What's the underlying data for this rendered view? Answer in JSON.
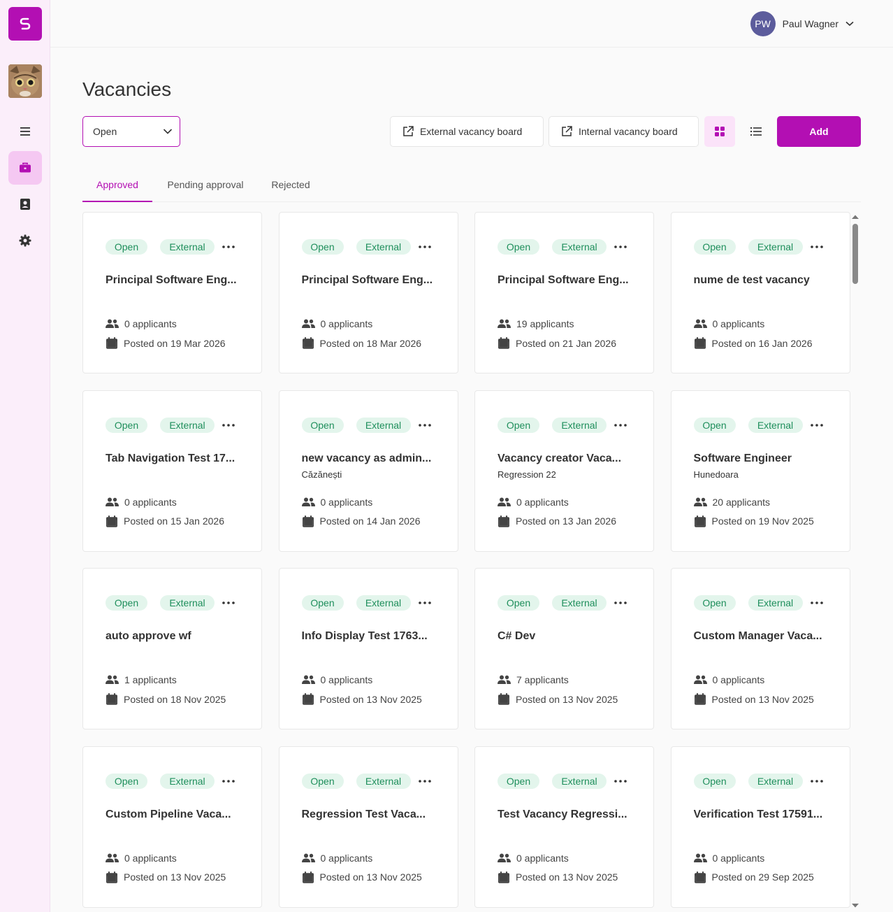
{
  "user": {
    "initials": "PW",
    "name": "Paul Wagner"
  },
  "page": {
    "title": "Vacancies",
    "status_filter": "Open",
    "external_board_label": "External vacancy board",
    "internal_board_label": "Internal vacancy board",
    "add_label": "Add"
  },
  "tabs": [
    {
      "label": "Approved",
      "active": true
    },
    {
      "label": "Pending approval",
      "active": false
    },
    {
      "label": "Rejected",
      "active": false
    }
  ],
  "colors": {
    "brand": "#b30fb3",
    "sidebar": "#fbeefa",
    "pill_bg": "#e3f5ec",
    "pill_text": "#1f8f5c"
  },
  "cards": [
    {
      "status": "Open",
      "visibility": "External",
      "title": "Principal Software Eng...",
      "subtitle": "",
      "applicants": "0 applicants",
      "posted": "Posted on 19 Mar 2026"
    },
    {
      "status": "Open",
      "visibility": "External",
      "title": "Principal Software Eng...",
      "subtitle": "",
      "applicants": "0 applicants",
      "posted": "Posted on 18 Mar 2026"
    },
    {
      "status": "Open",
      "visibility": "External",
      "title": "Principal Software Eng...",
      "subtitle": "",
      "applicants": "19 applicants",
      "posted": "Posted on 21 Jan 2026"
    },
    {
      "status": "Open",
      "visibility": "External",
      "title": "nume de test vacancy",
      "subtitle": "",
      "applicants": "0 applicants",
      "posted": "Posted on 16 Jan 2026"
    },
    {
      "status": "Open",
      "visibility": "External",
      "title": "Tab Navigation Test 17...",
      "subtitle": "",
      "applicants": "0 applicants",
      "posted": "Posted on 15 Jan 2026"
    },
    {
      "status": "Open",
      "visibility": "External",
      "title": "new vacancy as admin...",
      "subtitle": "Căzănești",
      "applicants": "0 applicants",
      "posted": "Posted on 14 Jan 2026"
    },
    {
      "status": "Open",
      "visibility": "External",
      "title": "Vacancy creator Vaca...",
      "subtitle": "Regression 22",
      "applicants": "0 applicants",
      "posted": "Posted on 13 Jan 2026"
    },
    {
      "status": "Open",
      "visibility": "External",
      "title": "Software Engineer",
      "subtitle": "Hunedoara",
      "applicants": "20 applicants",
      "posted": "Posted on 19 Nov 2025"
    },
    {
      "status": "Open",
      "visibility": "External",
      "title": "auto approve wf",
      "subtitle": "",
      "applicants": "1 applicants",
      "posted": "Posted on 18 Nov 2025"
    },
    {
      "status": "Open",
      "visibility": "External",
      "title": "Info Display Test 1763...",
      "subtitle": "",
      "applicants": "0 applicants",
      "posted": "Posted on 13 Nov 2025"
    },
    {
      "status": "Open",
      "visibility": "External",
      "title": "C# Dev",
      "subtitle": "",
      "applicants": "7 applicants",
      "posted": "Posted on 13 Nov 2025"
    },
    {
      "status": "Open",
      "visibility": "External",
      "title": "Custom Manager Vaca...",
      "subtitle": "",
      "applicants": "0 applicants",
      "posted": "Posted on 13 Nov 2025"
    },
    {
      "status": "Open",
      "visibility": "External",
      "title": "Custom Pipeline Vaca...",
      "subtitle": "",
      "applicants": "0 applicants",
      "posted": "Posted on 13 Nov 2025"
    },
    {
      "status": "Open",
      "visibility": "External",
      "title": "Regression Test Vaca...",
      "subtitle": "",
      "applicants": "0 applicants",
      "posted": "Posted on 13 Nov 2025"
    },
    {
      "status": "Open",
      "visibility": "External",
      "title": "Test Vacancy Regressi...",
      "subtitle": "",
      "applicants": "0 applicants",
      "posted": "Posted on 13 Nov 2025"
    },
    {
      "status": "Open",
      "visibility": "External",
      "title": "Verification Test 17591...",
      "subtitle": "",
      "applicants": "0 applicants",
      "posted": "Posted on 29 Sep 2025"
    }
  ]
}
